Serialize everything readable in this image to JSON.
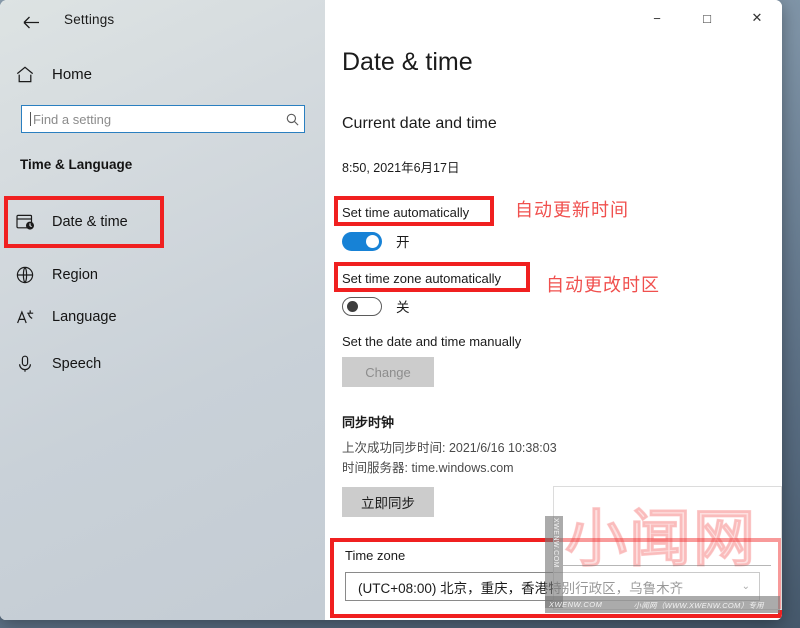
{
  "window": {
    "title": "Settings",
    "back_icon": "back-arrow-icon",
    "controls": {
      "minimize": "−",
      "maximize": "□",
      "close": "✕"
    }
  },
  "sidebar": {
    "home": {
      "label": "Home",
      "icon": "home-icon"
    },
    "search": {
      "placeholder": "Find a setting",
      "icon": "search-icon"
    },
    "section_title": "Time & Language",
    "items": [
      {
        "label": "Date & time",
        "icon": "calendar-clock-icon",
        "selected": true
      },
      {
        "label": "Region",
        "icon": "globe-icon",
        "selected": false
      },
      {
        "label": "Language",
        "icon": "language-icon",
        "selected": false
      },
      {
        "label": "Speech",
        "icon": "microphone-icon",
        "selected": false
      }
    ]
  },
  "main": {
    "page_title": "Date & time",
    "current_section_heading": "Current date and time",
    "current_datetime": "8:50, 2021年6月17日",
    "set_time_auto": {
      "label": "Set time automatically",
      "state_text": "开",
      "on": true
    },
    "set_timezone_auto": {
      "label": "Set time zone automatically",
      "state_text": "关",
      "on": false
    },
    "manual": {
      "label": "Set the date and time manually",
      "button_label": "Change",
      "button_disabled": true
    },
    "sync": {
      "heading": "同步时钟",
      "last_sync": "上次成功同步时间: 2021/6/16 10:38:03",
      "server": "时间服务器: time.windows.com",
      "button_label": "立即同步"
    },
    "timezone": {
      "label": "Time zone",
      "value": "(UTC+08:00) 北京，重庆，香港特别行政区，乌鲁木齐",
      "chevron": "⌄"
    }
  },
  "annotations": {
    "color": "#f02020",
    "text_color": "#f0504e",
    "note_time": "自动更新时间",
    "note_timezone": "自动更改时区"
  },
  "watermark": {
    "big": "小闻网",
    "vertical": "XWENW.COM",
    "left": "XWENW.COM",
    "right": "小闻网（WWW.XWENW.COM）专用"
  }
}
